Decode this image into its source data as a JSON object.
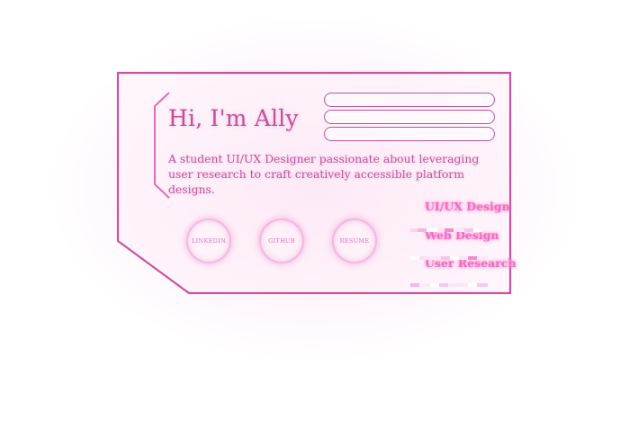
{
  "profile": {
    "greeting": "Hi, I'm Ally",
    "bio": "A student UI/UX Designer passionate about leveraging user research to craft creatively accessible platform designs."
  },
  "socials": [
    {
      "label": "LINKEDIN"
    },
    {
      "label": "GITHUB"
    },
    {
      "label": "RESUME"
    }
  ],
  "skills": [
    {
      "label": "UI/UX Design"
    },
    {
      "label": "Web Design"
    },
    {
      "label": "User Research"
    }
  ],
  "colors": {
    "accent": "#c9549c",
    "glow": "#f06ec2",
    "text": "#c0509a"
  }
}
